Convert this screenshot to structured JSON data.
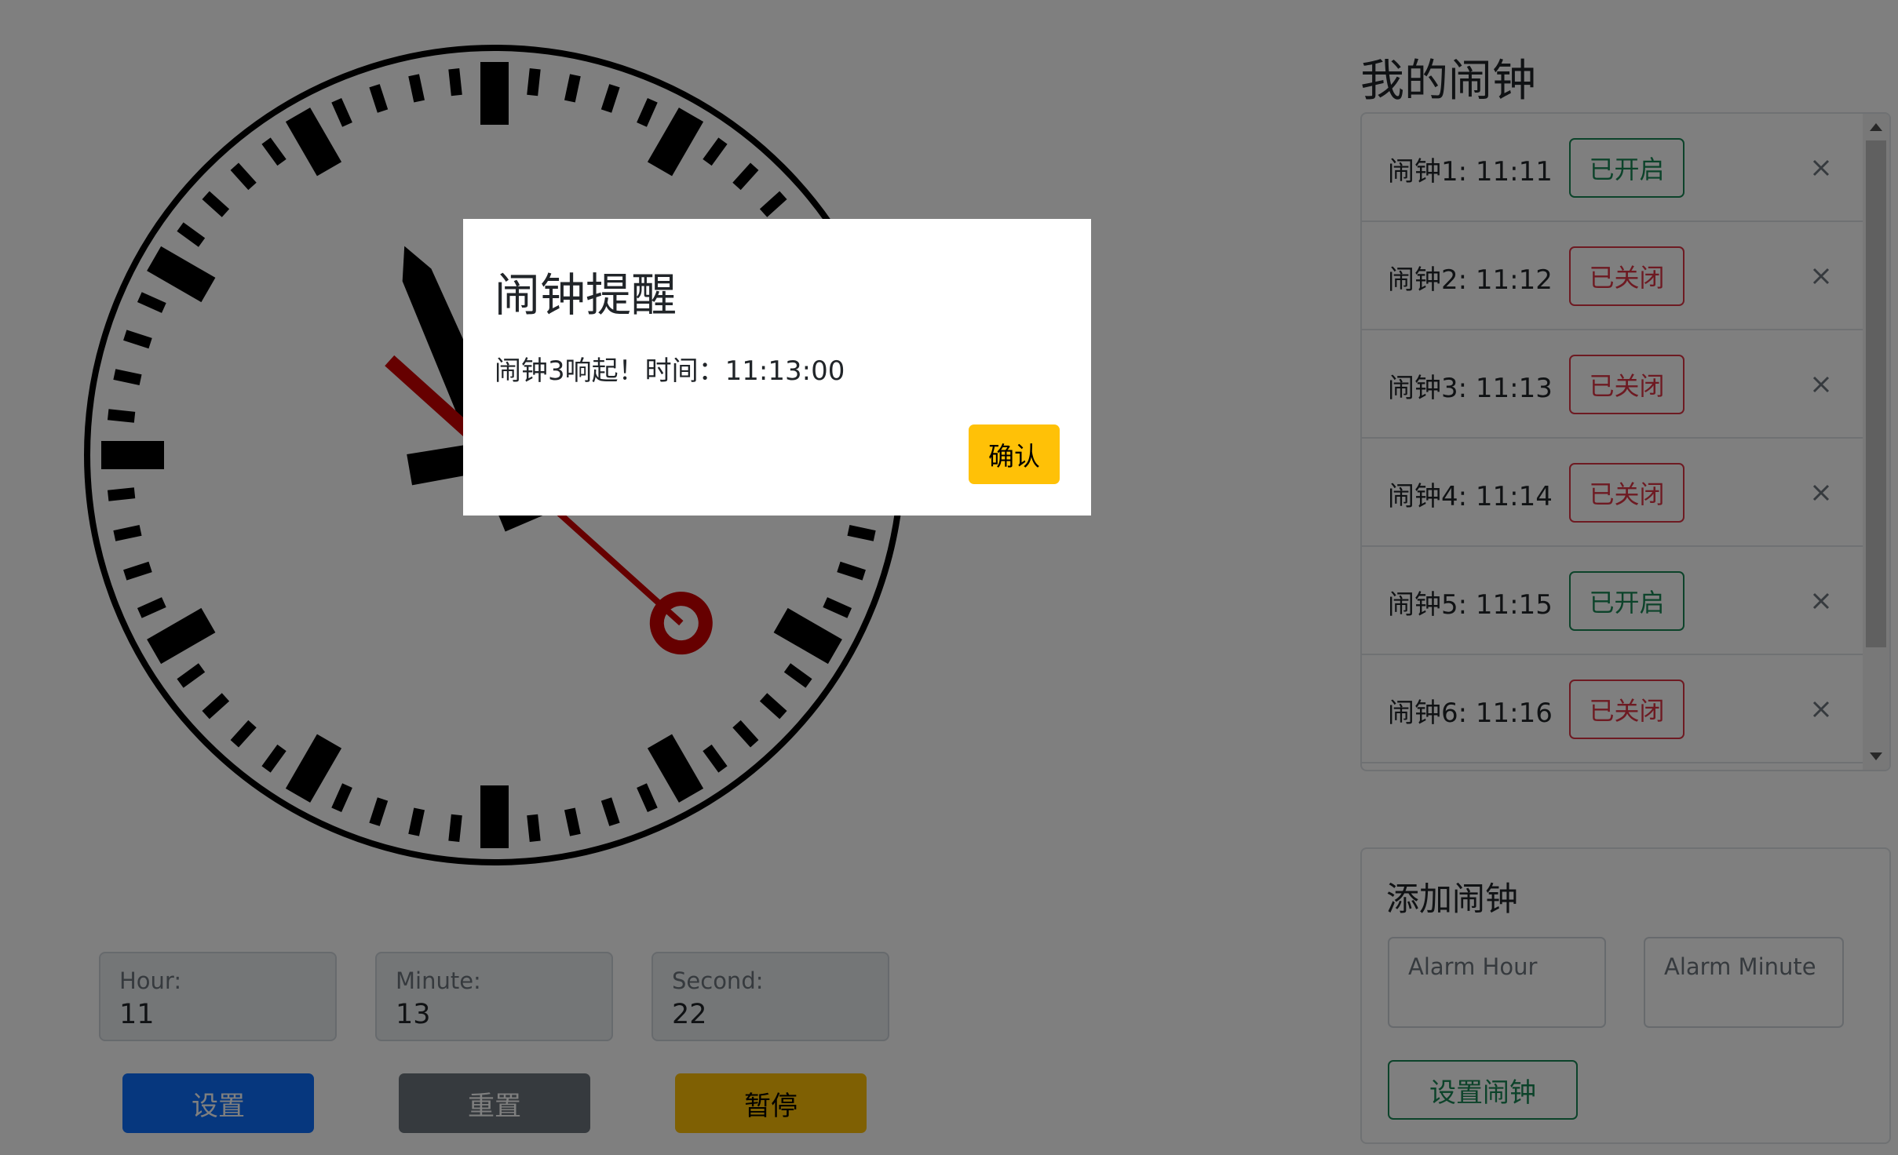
{
  "clock": {
    "hour": 11,
    "minute": 13,
    "second": 22,
    "colors": {
      "face": "#ffffff",
      "marks": "#000000",
      "second_hand": "#cc0000"
    }
  },
  "time_inputs": [
    {
      "label": "Hour:",
      "value": "11"
    },
    {
      "label": "Minute:",
      "value": "13"
    },
    {
      "label": "Second:",
      "value": "22"
    }
  ],
  "controls": {
    "set_label": "设置",
    "reset_label": "重置",
    "pause_label": "暂停"
  },
  "alarms_panel": {
    "title": "我的闹钟",
    "items": [
      {
        "name": "闹钟1: 11:11",
        "status": "已开启",
        "on": true
      },
      {
        "name": "闹钟2: 11:12",
        "status": "已关闭",
        "on": false
      },
      {
        "name": "闹钟3: 11:13",
        "status": "已关闭",
        "on": false
      },
      {
        "name": "闹钟4: 11:14",
        "status": "已关闭",
        "on": false
      },
      {
        "name": "闹钟5: 11:15",
        "status": "已开启",
        "on": true
      },
      {
        "name": "闹钟6: 11:16",
        "status": "已关闭",
        "on": false
      }
    ]
  },
  "add_alarm": {
    "title": "添加闹钟",
    "hour_placeholder": "Alarm Hour",
    "minute_placeholder": "Alarm Minute",
    "button_label": "设置闹钟"
  },
  "modal": {
    "title": "闹钟提醒",
    "body": "闹钟3响起！时间：11:13:00",
    "confirm_label": "确认"
  },
  "colors": {
    "primary": "#0d6efd",
    "secondary": "#6c757d",
    "warning": "#ffc107",
    "success": "#198754",
    "danger": "#dc3545"
  }
}
